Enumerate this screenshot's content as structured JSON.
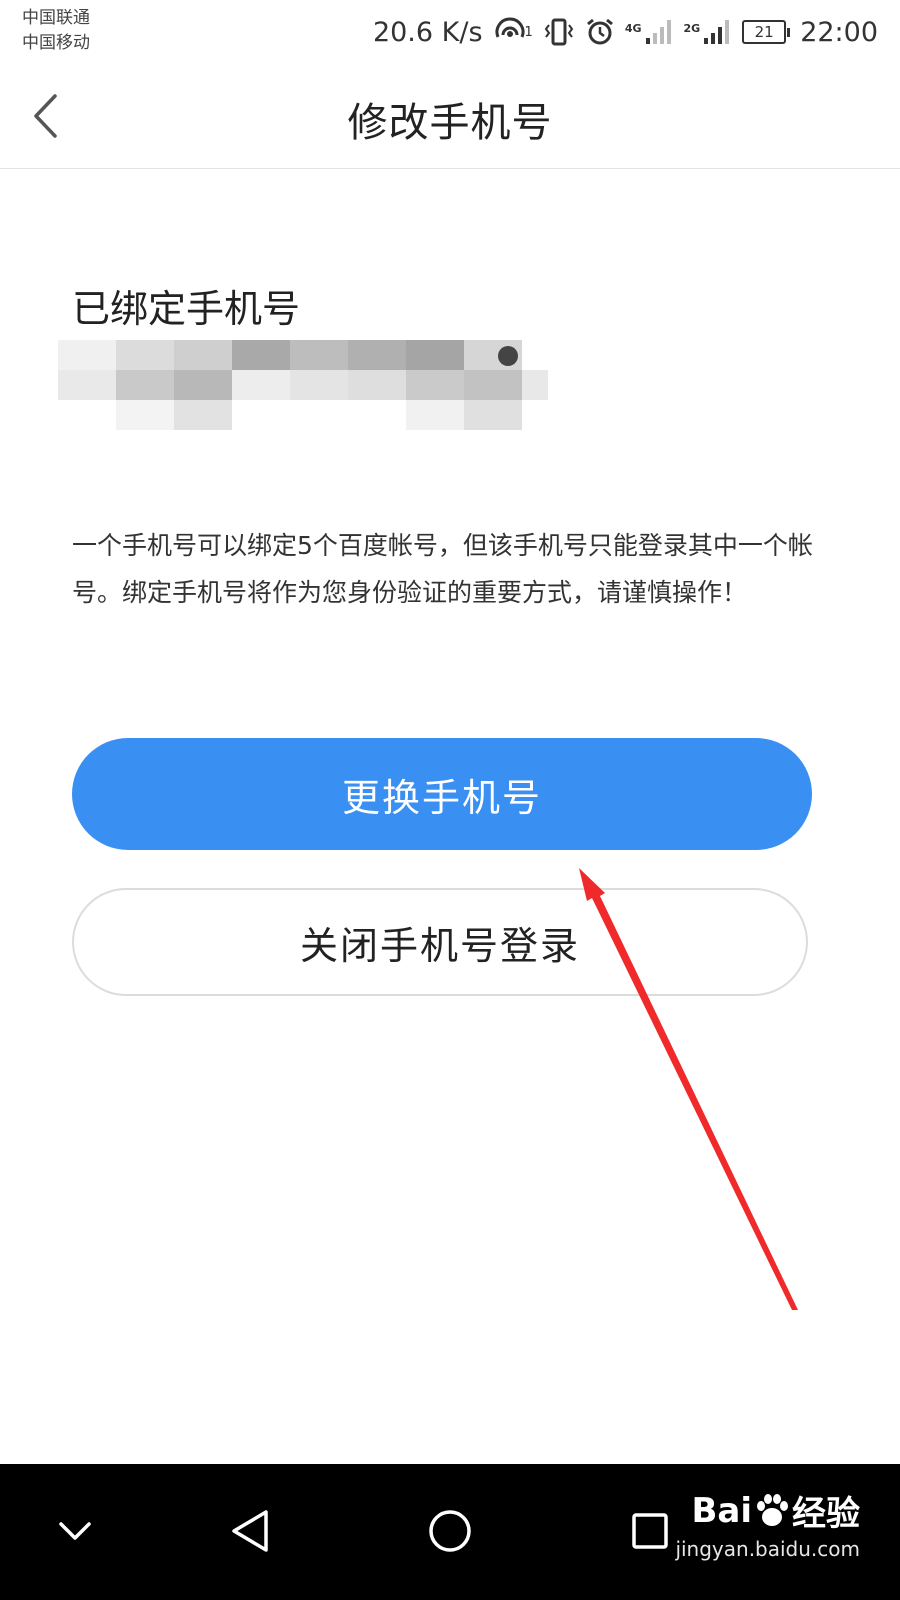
{
  "status_bar": {
    "carrier_1": "中国联通",
    "carrier_2": "中国移动",
    "net_speed": "20.6 K/s",
    "hotspot_badge": "1",
    "signal_1_type": "4G",
    "signal_2_type": "2G",
    "battery_level": "21",
    "time": "22:00",
    "icons": [
      "hotspot-icon",
      "vibrate-icon",
      "alarm-icon",
      "signal-4g-icon",
      "signal-2g-icon",
      "battery-icon"
    ]
  },
  "header": {
    "title": "修改手机号",
    "back_icon": "chevron-left-icon"
  },
  "content": {
    "bound_label": "已绑定手机号",
    "notice": "一个手机号可以绑定5个百度帐号，但该手机号只能登录其中一个帐号。绑定手机号将作为您身份验证的重要方式，请谨慎操作！",
    "change_button": "更换手机号",
    "close_login_button": "关闭手机号登录"
  },
  "nav_bar": {
    "icons": [
      "chevron-down-icon",
      "back-triangle-icon",
      "home-circle-icon",
      "recents-square-icon"
    ]
  },
  "watermark": {
    "brand_left": "Bai",
    "brand_right": "经验",
    "url": "jingyan.baidu.com"
  },
  "colors": {
    "primary_button": "#3a8ff2",
    "annotation_arrow": "#f02a2a",
    "nav_background": "#000000"
  }
}
